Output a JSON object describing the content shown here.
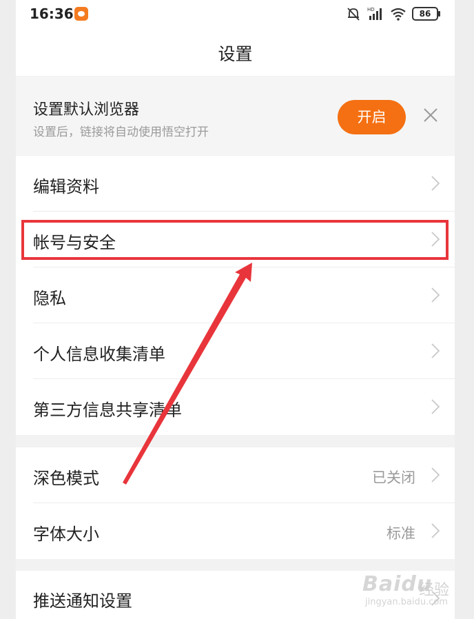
{
  "status_bar": {
    "time": "16:36",
    "battery": "86",
    "icons": [
      "app-notification-icon",
      "bell-off-icon",
      "hd-signal-icon",
      "wifi-icon",
      "battery-icon"
    ]
  },
  "header": {
    "title": "设置"
  },
  "banner": {
    "title": "设置默认浏览器",
    "subtitle": "设置后，链接将自动使用悟空打开",
    "button_label": "开启",
    "button_color": "#f47012"
  },
  "groups": [
    {
      "items": [
        {
          "label": "编辑资料"
        },
        {
          "label": "帐号与安全"
        },
        {
          "label": "隐私"
        },
        {
          "label": "个人信息收集清单"
        },
        {
          "label": "第三方信息共享清单"
        }
      ]
    },
    {
      "items": [
        {
          "label": "深色模式",
          "value": "已关闭"
        },
        {
          "label": "字体大小",
          "value": "标准"
        }
      ]
    },
    {
      "items": [
        {
          "label": "推送通知设置"
        }
      ]
    }
  ],
  "annotation": {
    "highlight_color": "#e8353b"
  },
  "watermark": {
    "brand": "Baidu",
    "brand_cn": "经验",
    "url": "jingyan.baidu.com"
  }
}
